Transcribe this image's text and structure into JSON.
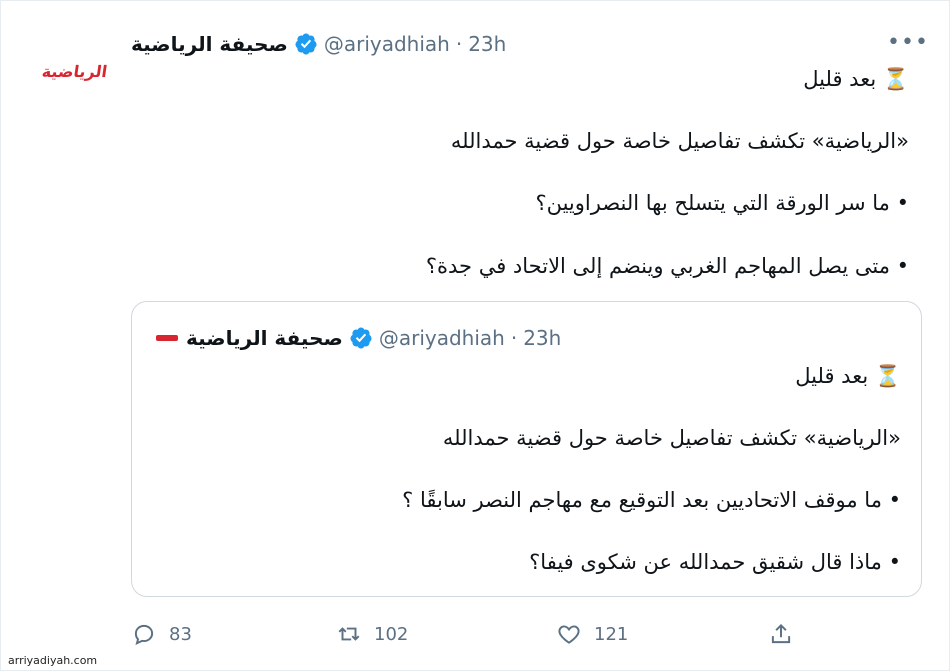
{
  "tweet": {
    "author_name": "صحيفة الرياضية",
    "handle": "@ariyadhiah",
    "separator": "·",
    "time": "23h",
    "avatar_logo_text": "الرياضية",
    "lines": [
      "⏳ بعد قليل",
      "«الرياضية» تكشف تفاصيل خاصة حول قضية حمدالله",
      "• ما سر الورقة التي يتسلح بها النصراويين؟",
      "• متى يصل المهاجم الغربي وينضم إلى الاتحاد في جدة؟"
    ]
  },
  "quoted": {
    "author_name": "صحيفة الرياضية",
    "handle": "@ariyadhiah",
    "separator": "·",
    "time": "23h",
    "lines": [
      "⏳ بعد قليل",
      "«الرياضية» تكشف تفاصيل خاصة حول قضية حمدالله",
      "• ما موقف الاتحاديين بعد التوقيع مع مهاجم النصر سابقًا ؟",
      "• ماذا قال شقيق حمدالله عن شكوى فيفا؟"
    ]
  },
  "actions": {
    "replies": "83",
    "retweets": "102",
    "likes": "121"
  },
  "more_label": "•••",
  "watermark": "arriyadiyah.com",
  "colors": {
    "verified": "#1d9bf0",
    "muted": "#5b7083",
    "text": "#0f1419",
    "brand_red": "#d7262f"
  },
  "icons": {
    "verified": "verified-badge-icon",
    "reply": "reply-icon",
    "retweet": "retweet-icon",
    "like": "heart-icon",
    "share": "share-icon",
    "more": "more-options-icon"
  }
}
